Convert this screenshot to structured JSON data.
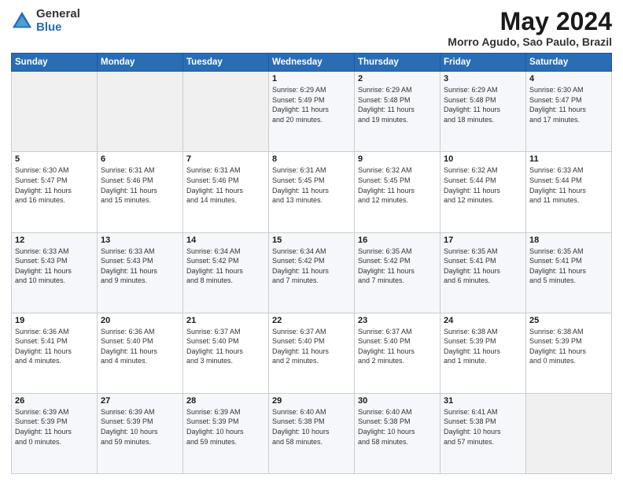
{
  "logo": {
    "general": "General",
    "blue": "Blue"
  },
  "title": {
    "month": "May 2024",
    "location": "Morro Agudo, Sao Paulo, Brazil"
  },
  "headers": [
    "Sunday",
    "Monday",
    "Tuesday",
    "Wednesday",
    "Thursday",
    "Friday",
    "Saturday"
  ],
  "weeks": [
    [
      {
        "day": "",
        "info": ""
      },
      {
        "day": "",
        "info": ""
      },
      {
        "day": "",
        "info": ""
      },
      {
        "day": "1",
        "info": "Sunrise: 6:29 AM\nSunset: 5:49 PM\nDaylight: 11 hours\nand 20 minutes."
      },
      {
        "day": "2",
        "info": "Sunrise: 6:29 AM\nSunset: 5:48 PM\nDaylight: 11 hours\nand 19 minutes."
      },
      {
        "day": "3",
        "info": "Sunrise: 6:29 AM\nSunset: 5:48 PM\nDaylight: 11 hours\nand 18 minutes."
      },
      {
        "day": "4",
        "info": "Sunrise: 6:30 AM\nSunset: 5:47 PM\nDaylight: 11 hours\nand 17 minutes."
      }
    ],
    [
      {
        "day": "5",
        "info": "Sunrise: 6:30 AM\nSunset: 5:47 PM\nDaylight: 11 hours\nand 16 minutes."
      },
      {
        "day": "6",
        "info": "Sunrise: 6:31 AM\nSunset: 5:46 PM\nDaylight: 11 hours\nand 15 minutes."
      },
      {
        "day": "7",
        "info": "Sunrise: 6:31 AM\nSunset: 5:46 PM\nDaylight: 11 hours\nand 14 minutes."
      },
      {
        "day": "8",
        "info": "Sunrise: 6:31 AM\nSunset: 5:45 PM\nDaylight: 11 hours\nand 13 minutes."
      },
      {
        "day": "9",
        "info": "Sunrise: 6:32 AM\nSunset: 5:45 PM\nDaylight: 11 hours\nand 12 minutes."
      },
      {
        "day": "10",
        "info": "Sunrise: 6:32 AM\nSunset: 5:44 PM\nDaylight: 11 hours\nand 12 minutes."
      },
      {
        "day": "11",
        "info": "Sunrise: 6:33 AM\nSunset: 5:44 PM\nDaylight: 11 hours\nand 11 minutes."
      }
    ],
    [
      {
        "day": "12",
        "info": "Sunrise: 6:33 AM\nSunset: 5:43 PM\nDaylight: 11 hours\nand 10 minutes."
      },
      {
        "day": "13",
        "info": "Sunrise: 6:33 AM\nSunset: 5:43 PM\nDaylight: 11 hours\nand 9 minutes."
      },
      {
        "day": "14",
        "info": "Sunrise: 6:34 AM\nSunset: 5:42 PM\nDaylight: 11 hours\nand 8 minutes."
      },
      {
        "day": "15",
        "info": "Sunrise: 6:34 AM\nSunset: 5:42 PM\nDaylight: 11 hours\nand 7 minutes."
      },
      {
        "day": "16",
        "info": "Sunrise: 6:35 AM\nSunset: 5:42 PM\nDaylight: 11 hours\nand 7 minutes."
      },
      {
        "day": "17",
        "info": "Sunrise: 6:35 AM\nSunset: 5:41 PM\nDaylight: 11 hours\nand 6 minutes."
      },
      {
        "day": "18",
        "info": "Sunrise: 6:35 AM\nSunset: 5:41 PM\nDaylight: 11 hours\nand 5 minutes."
      }
    ],
    [
      {
        "day": "19",
        "info": "Sunrise: 6:36 AM\nSunset: 5:41 PM\nDaylight: 11 hours\nand 4 minutes."
      },
      {
        "day": "20",
        "info": "Sunrise: 6:36 AM\nSunset: 5:40 PM\nDaylight: 11 hours\nand 4 minutes."
      },
      {
        "day": "21",
        "info": "Sunrise: 6:37 AM\nSunset: 5:40 PM\nDaylight: 11 hours\nand 3 minutes."
      },
      {
        "day": "22",
        "info": "Sunrise: 6:37 AM\nSunset: 5:40 PM\nDaylight: 11 hours\nand 2 minutes."
      },
      {
        "day": "23",
        "info": "Sunrise: 6:37 AM\nSunset: 5:40 PM\nDaylight: 11 hours\nand 2 minutes."
      },
      {
        "day": "24",
        "info": "Sunrise: 6:38 AM\nSunset: 5:39 PM\nDaylight: 11 hours\nand 1 minute."
      },
      {
        "day": "25",
        "info": "Sunrise: 6:38 AM\nSunset: 5:39 PM\nDaylight: 11 hours\nand 0 minutes."
      }
    ],
    [
      {
        "day": "26",
        "info": "Sunrise: 6:39 AM\nSunset: 5:39 PM\nDaylight: 11 hours\nand 0 minutes."
      },
      {
        "day": "27",
        "info": "Sunrise: 6:39 AM\nSunset: 5:39 PM\nDaylight: 10 hours\nand 59 minutes."
      },
      {
        "day": "28",
        "info": "Sunrise: 6:39 AM\nSunset: 5:39 PM\nDaylight: 10 hours\nand 59 minutes."
      },
      {
        "day": "29",
        "info": "Sunrise: 6:40 AM\nSunset: 5:38 PM\nDaylight: 10 hours\nand 58 minutes."
      },
      {
        "day": "30",
        "info": "Sunrise: 6:40 AM\nSunset: 5:38 PM\nDaylight: 10 hours\nand 58 minutes."
      },
      {
        "day": "31",
        "info": "Sunrise: 6:41 AM\nSunset: 5:38 PM\nDaylight: 10 hours\nand 57 minutes."
      },
      {
        "day": "",
        "info": ""
      }
    ]
  ]
}
